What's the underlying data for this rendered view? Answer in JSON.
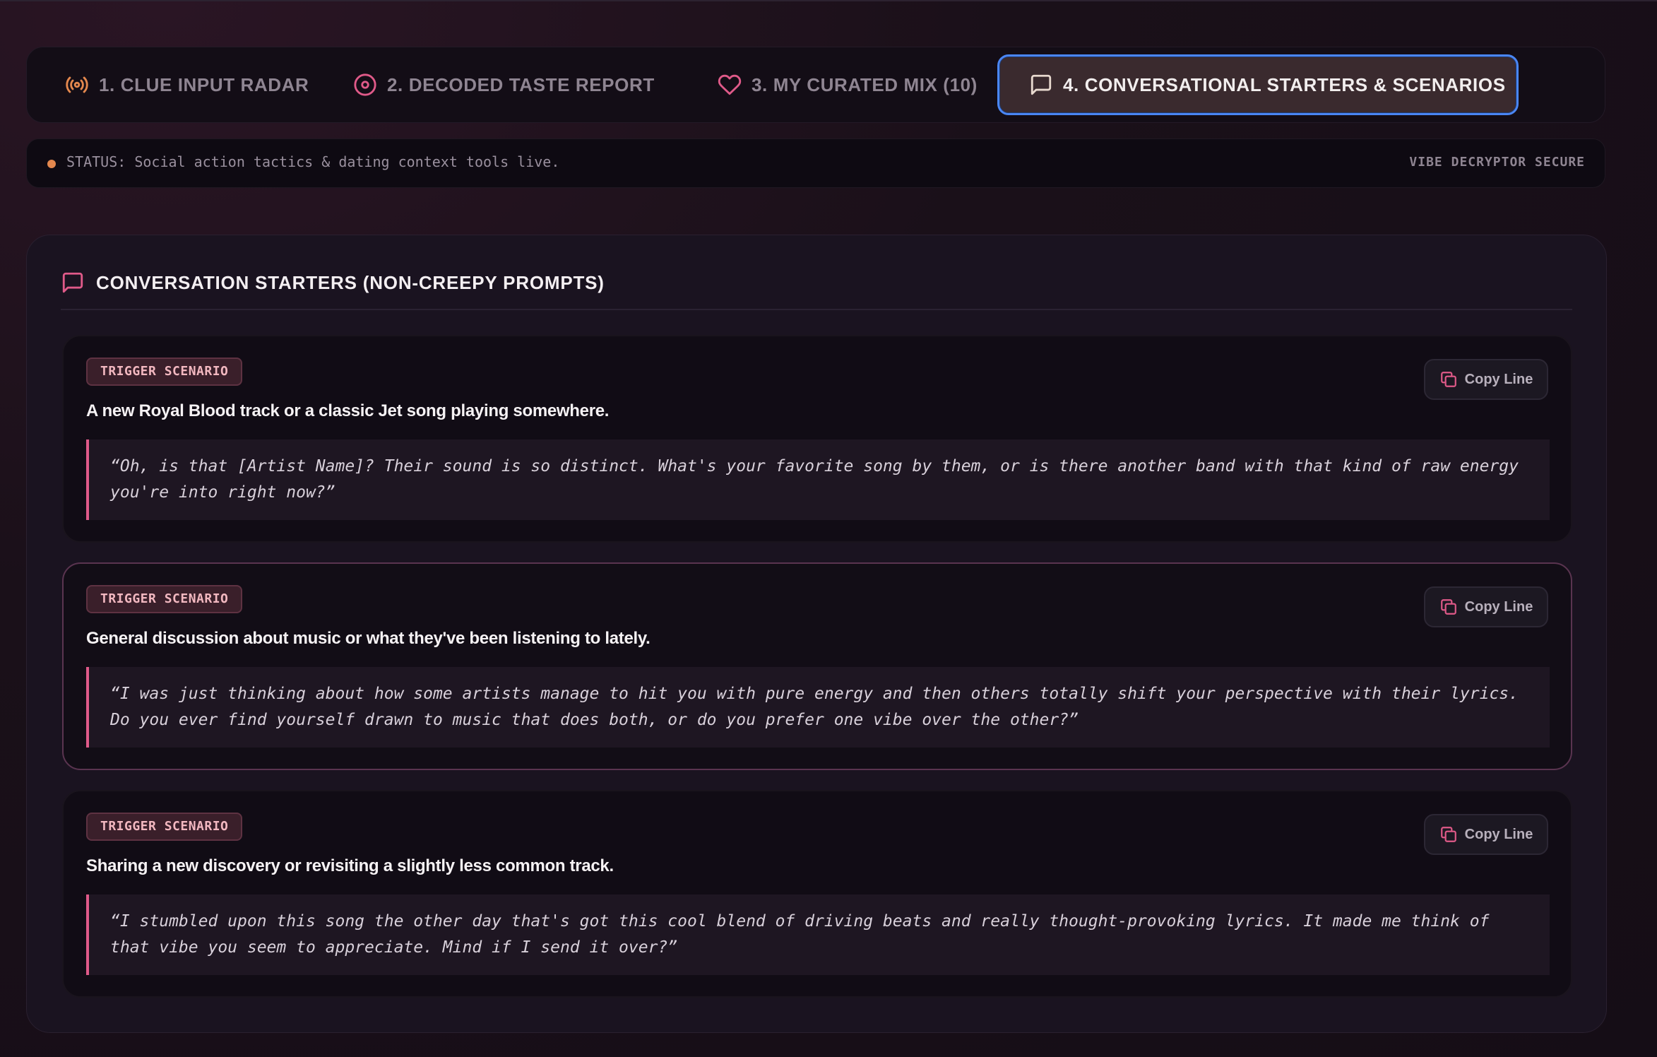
{
  "tabs": [
    {
      "label": "1. CLUE INPUT RADAR",
      "icon": "radar-icon",
      "active": false
    },
    {
      "label": "2. DECODED TASTE REPORT",
      "icon": "target-icon",
      "active": false
    },
    {
      "label": "3. MY CURATED MIX (10)",
      "icon": "heart-icon",
      "active": false
    },
    {
      "label": "4. CONVERSATIONAL STARTERS & SCENARIOS",
      "icon": "chat-bubble-icon",
      "active": true
    }
  ],
  "status": {
    "text": "STATUS: Social action tactics & dating context tools live.",
    "right_label": "VIBE DECRYPTOR SECURE",
    "dot_color": "#e4884e"
  },
  "panel": {
    "title": "CONVERSATION STARTERS (NON-CREEPY PROMPTS)",
    "icon": "chat-bubble-icon"
  },
  "cards": [
    {
      "badge": "TRIGGER SCENARIO",
      "scenario": "A new Royal Blood track or a classic Jet song playing somewhere.",
      "quote": "“Oh, is that [Artist Name]? Their sound is so distinct. What's your favorite song by them, or is there another band with that kind of raw energy you're into right now?”",
      "copy_label": "Copy Line"
    },
    {
      "badge": "TRIGGER SCENARIO",
      "scenario": "General discussion about music or what they've been listening to lately.",
      "quote": "“I was just thinking about how some artists manage to hit you with pure energy and then others totally shift your perspective with their lyrics. Do you ever find yourself drawn to music that does both, or do you prefer one vibe over the other?”",
      "copy_label": "Copy Line"
    },
    {
      "badge": "TRIGGER SCENARIO",
      "scenario": "Sharing a new discovery or revisiting a slightly less common track.",
      "quote": "“I stumbled upon this song the other day that's got this cool blend of driving beats and really thought-provoking lyrics. It made me think of that vibe you seem to appreciate. Mind if I send it over?”",
      "copy_label": "Copy Line"
    }
  ],
  "colors": {
    "accent_pink": "#e05a89",
    "accent_orange": "#e4884e",
    "active_tab_border": "#4a86f4"
  }
}
